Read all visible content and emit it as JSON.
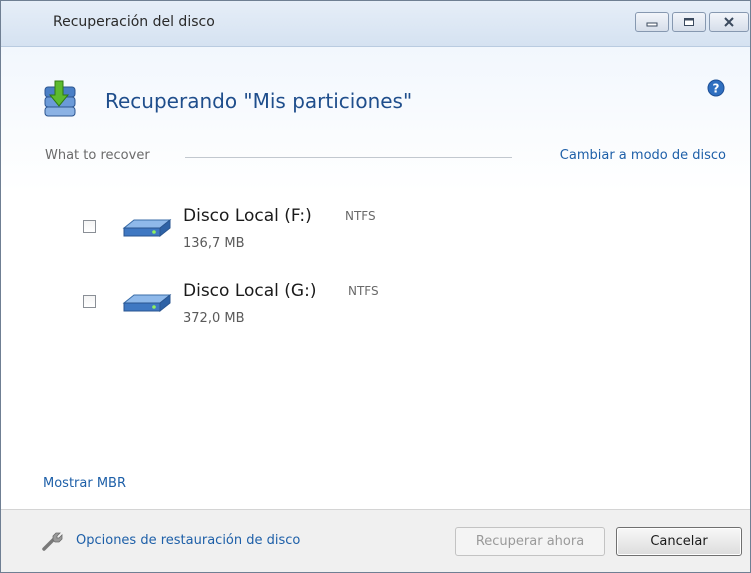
{
  "window": {
    "title": "Recuperación del disco"
  },
  "header": {
    "title": "Recuperando \"Mis particiones\""
  },
  "section": {
    "label": "What to recover",
    "mode_link": "Cambiar a modo de disco"
  },
  "partitions": [
    {
      "name": "Disco Local (F:)",
      "fs": "NTFS",
      "size": "136,7 MB",
      "checked": false
    },
    {
      "name": "Disco Local (G:)",
      "fs": "NTFS",
      "size": "372,0 MB",
      "checked": false
    }
  ],
  "links": {
    "show_mbr": "Mostrar MBR",
    "restore_options": "Opciones de restauración de disco"
  },
  "buttons": {
    "recover_now": "Recuperar ahora",
    "cancel": "Cancelar"
  },
  "icons": {
    "app": "disk-recovery-icon",
    "help": "help-icon",
    "wrench": "wrench-icon",
    "disk": "disk-icon"
  },
  "colors": {
    "link": "#1d5fa8",
    "title": "#1f4e8c"
  }
}
